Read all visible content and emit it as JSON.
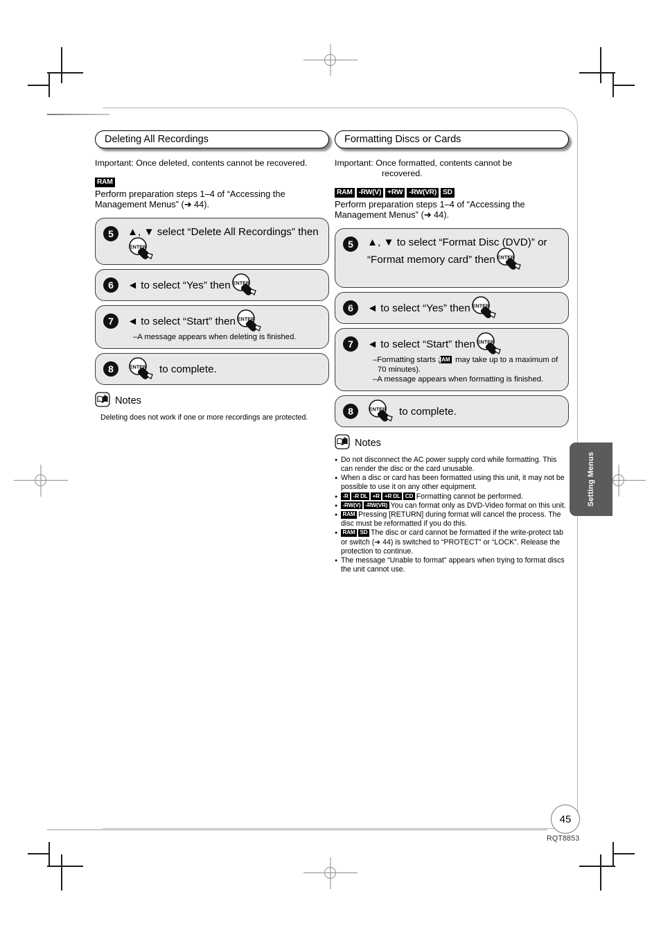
{
  "document": {
    "page_number": "45",
    "doc_code": "RQT8853",
    "side_tab": "Setting Menus"
  },
  "left_column": {
    "heading": "Deleting All Recordings",
    "important": "Important: Once deleted, contents cannot be recovered.",
    "media_badges": [
      "RAM"
    ],
    "prep_text": "Perform preparation steps 1–4 of “Accessing the Management Menus” (➜ 44).",
    "steps": [
      {
        "number": "5",
        "main": "▲, ▼ select “Delete All Recordings” then",
        "enter_icon": "enter-key-icon",
        "sub": []
      },
      {
        "number": "6",
        "main": "◄ to select “Yes” then",
        "enter_icon": "enter-key-icon",
        "sub": []
      },
      {
        "number": "7",
        "main": "◄ to select “Start” then",
        "enter_icon": "enter-key-icon",
        "sub": [
          "–A message appears when deleting is finished."
        ]
      },
      {
        "number": "8",
        "main": "to complete.",
        "enter_icon": "enter-key-icon",
        "enter_first": true,
        "sub": []
      }
    ],
    "notes_title": "Notes",
    "notes": [
      "Deleting does not work if one or more recordings are protected."
    ]
  },
  "right_column": {
    "heading": "Formatting Discs or Cards",
    "important_line1": "Important: Once formatted, contents cannot be",
    "important_line2": "recovered.",
    "media_badges": [
      "RAM",
      "-RW(V)",
      "+RW",
      "-RW(VR)",
      "SD"
    ],
    "prep_text": "Perform preparation steps 1–4 of “Accessing the Management Menus” (➜ 44).",
    "steps": [
      {
        "number": "5",
        "main": "▲, ▼ to select “Format Disc (DVD)” or “Format memory card” then",
        "enter_icon": "enter-key-icon",
        "sub": []
      },
      {
        "number": "6",
        "main": "◄ to select “Yes” then",
        "enter_icon": "enter-key-icon",
        "sub": []
      },
      {
        "number": "7",
        "main": "◄ to select “Start” then",
        "enter_icon": "enter-key-icon",
        "sub_pre": "–Formatting starts (",
        "sub_badge": "RAM",
        "sub_post": " may take up to a maximum of 70 minutes).",
        "sub2": "–A message appears when formatting is finished."
      },
      {
        "number": "8",
        "main": "to complete.",
        "enter_icon": "enter-key-icon",
        "enter_first": true,
        "sub": []
      }
    ],
    "notes_title": "Notes",
    "notes": [
      {
        "badges": [],
        "text": "Do not disconnect the AC power supply cord while formatting. This can render the disc or the card unusable."
      },
      {
        "badges": [],
        "text": "When a disc or card has been formatted using this unit, it may not be possible to use it on any other equipment."
      },
      {
        "badges": [
          "-R",
          "-R DL",
          "+R",
          "+R DL",
          "CD"
        ],
        "text": "Formatting cannot be performed."
      },
      {
        "badges": [
          "-RW(V)",
          "-RW(VR)"
        ],
        "text": "You can format only as DVD-Video format on this unit."
      },
      {
        "badges": [
          "RAM"
        ],
        "text": "Pressing [RETURN] during format will cancel the process. The disc must be reformatted if you do this."
      },
      {
        "badges": [
          "RAM",
          "SD"
        ],
        "text": "The disc or card cannot be formatted if the write-protect tab or switch (➜ 44) is switched to “PROTECT” or “LOCK”. Release the protection to continue."
      },
      {
        "badges": [],
        "text": "The message “Unable to format” appears when trying to format discs the unit cannot use."
      }
    ]
  },
  "colors": {
    "step_bg": "#e8e8e8",
    "badge_bg": "#000000",
    "side_tab_bg": "#5b5b5b",
    "frame_border": "#b3b3b3"
  }
}
